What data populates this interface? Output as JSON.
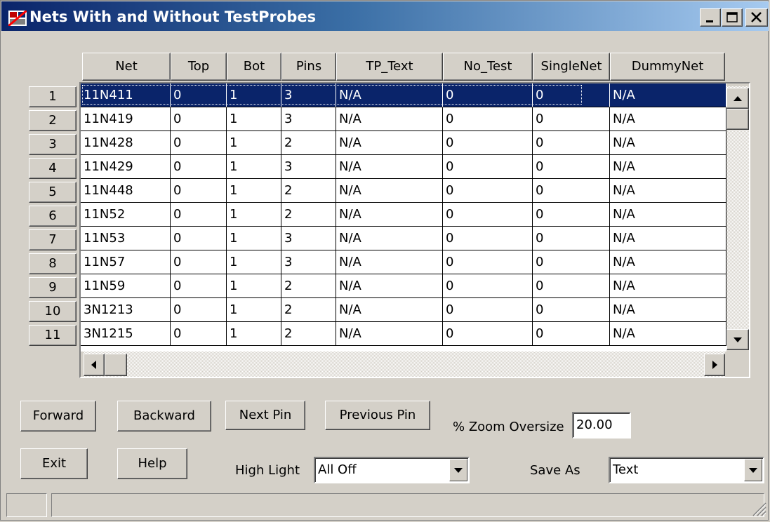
{
  "window": {
    "title": "Nets With and Without TestProbes",
    "icon": "app-icon",
    "controls": [
      "minimize-icon",
      "maximize-icon",
      "close-icon"
    ]
  },
  "grid": {
    "columns": [
      "Net",
      "Top",
      "Bot",
      "Pins",
      "TP_Text",
      "No_Test",
      "SingleNet",
      "DummyNet"
    ],
    "rows": [
      {
        "num": "1",
        "cells": [
          "11N411",
          "0",
          "1",
          "3",
          "N/A",
          "0",
          "0",
          "N/A"
        ],
        "selected": true
      },
      {
        "num": "2",
        "cells": [
          "11N419",
          "0",
          "1",
          "3",
          "N/A",
          "0",
          "0",
          "N/A"
        ]
      },
      {
        "num": "3",
        "cells": [
          "11N428",
          "0",
          "1",
          "2",
          "N/A",
          "0",
          "0",
          "N/A"
        ]
      },
      {
        "num": "4",
        "cells": [
          "11N429",
          "0",
          "1",
          "3",
          "N/A",
          "0",
          "0",
          "N/A"
        ]
      },
      {
        "num": "5",
        "cells": [
          "11N448",
          "0",
          "1",
          "2",
          "N/A",
          "0",
          "0",
          "N/A"
        ]
      },
      {
        "num": "6",
        "cells": [
          "11N52",
          "0",
          "1",
          "2",
          "N/A",
          "0",
          "0",
          "N/A"
        ]
      },
      {
        "num": "7",
        "cells": [
          "11N53",
          "0",
          "1",
          "3",
          "N/A",
          "0",
          "0",
          "N/A"
        ]
      },
      {
        "num": "8",
        "cells": [
          "11N57",
          "0",
          "1",
          "3",
          "N/A",
          "0",
          "0",
          "N/A"
        ]
      },
      {
        "num": "9",
        "cells": [
          "11N59",
          "0",
          "1",
          "2",
          "N/A",
          "0",
          "0",
          "N/A"
        ]
      },
      {
        "num": "10",
        "cells": [
          "3N1213",
          "0",
          "1",
          "2",
          "N/A",
          "0",
          "0",
          "N/A"
        ]
      },
      {
        "num": "11",
        "cells": [
          "3N1215",
          "0",
          "1",
          "2",
          "N/A",
          "0",
          "0",
          "N/A"
        ]
      }
    ]
  },
  "buttons": {
    "forward": "Forward",
    "backward": "Backward",
    "next_pin": "Next Pin",
    "previous_pin": "Previous Pin",
    "exit": "Exit",
    "help": "Help"
  },
  "zoom": {
    "label": "% Zoom Oversize",
    "value": "20.00"
  },
  "highlight": {
    "label": "High Light",
    "selected": "All Off"
  },
  "save_as": {
    "label": "Save As",
    "selected": "Text"
  },
  "colors": {
    "selection": "#0a246a",
    "face": "#d4d0c8"
  }
}
